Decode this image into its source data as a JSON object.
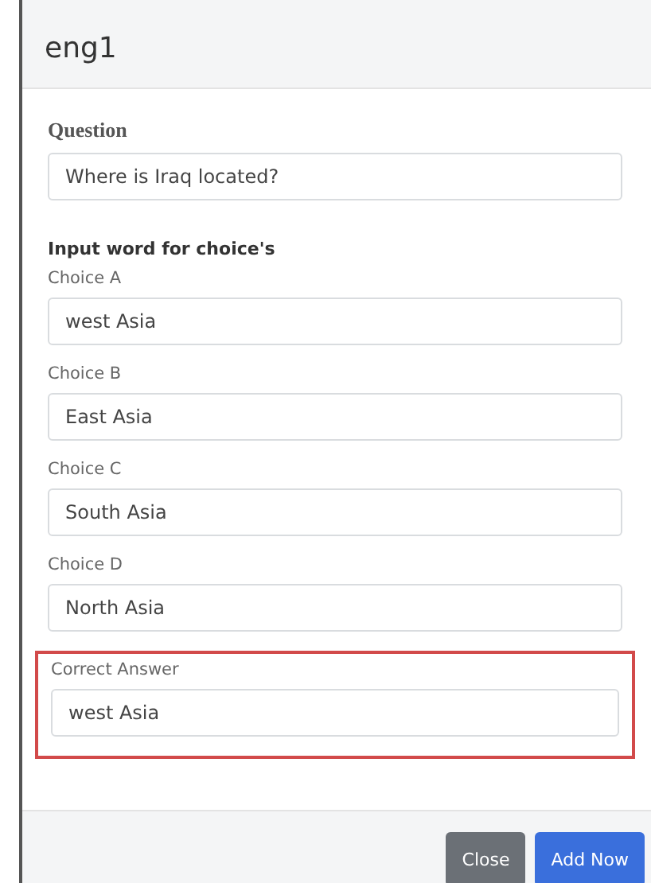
{
  "header": {
    "title": "eng1"
  },
  "question": {
    "label": "Question",
    "value": "Where is Iraq located?"
  },
  "choices_heading": "Input word for choice's",
  "choices": [
    {
      "label": "Choice A",
      "value": "west Asia"
    },
    {
      "label": "Choice B",
      "value": "East Asia"
    },
    {
      "label": "Choice C",
      "value": "South Asia"
    },
    {
      "label": "Choice D",
      "value": "North Asia"
    }
  ],
  "correct_answer": {
    "label": "Correct Answer",
    "value": "west Asia",
    "highlighted": true
  },
  "buttons": [
    {
      "label": "Close",
      "kind": "secondary"
    },
    {
      "label": "Add Now",
      "kind": "primary"
    }
  ]
}
